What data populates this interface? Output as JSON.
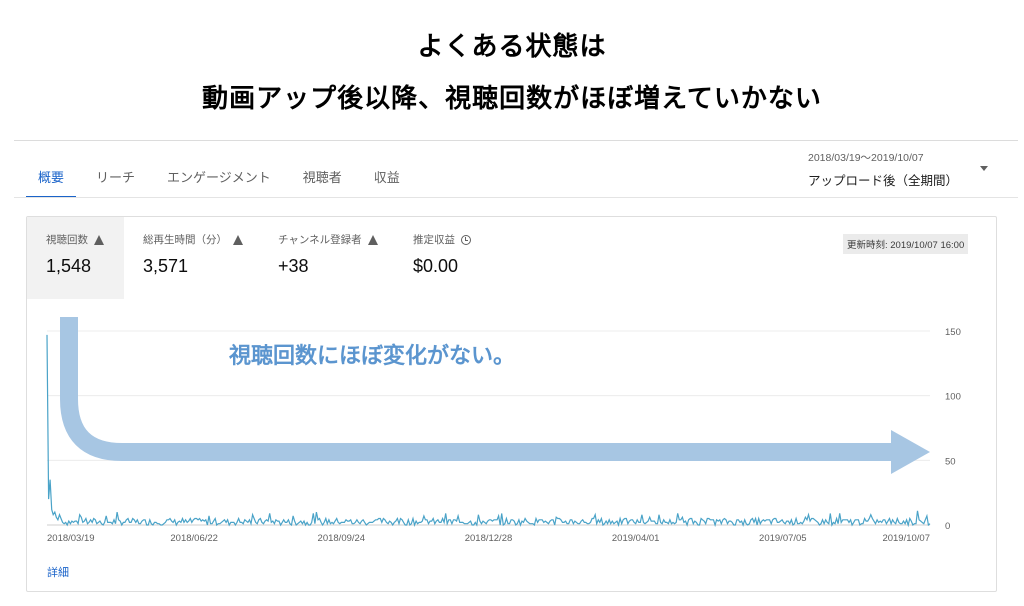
{
  "headline": {
    "line1": "よくある状態は",
    "line2": "動画アップ後以降、視聴回数がほぼ増えていかない"
  },
  "tabs": [
    {
      "label": "概要",
      "active": true
    },
    {
      "label": "リーチ",
      "active": false
    },
    {
      "label": "エンゲージメント",
      "active": false
    },
    {
      "label": "視聴者",
      "active": false
    },
    {
      "label": "収益",
      "active": false
    }
  ],
  "range": {
    "dates": "2018/03/19〜2019/10/07",
    "label": "アップロード後（全期間）"
  },
  "metrics": [
    {
      "label": "視聴回数",
      "value": "1,548",
      "icon": "warning-icon",
      "selected": true
    },
    {
      "label": "総再生時間（分）",
      "value": "3,571",
      "icon": "warning-icon",
      "selected": false
    },
    {
      "label": "チャンネル登録者",
      "value": "+38",
      "icon": "warning-icon",
      "selected": false
    },
    {
      "label": "推定収益",
      "value": "$0.00",
      "icon": "clock-icon",
      "selected": false
    }
  ],
  "updated": "更新時刻: 2019/10/07 16:00",
  "detail_link": "詳細",
  "annotation": {
    "text": "視聴回数にほぼ変化がない。",
    "arrow_color": "#a7c6e3",
    "text_color": "#5b95cf"
  },
  "colors": {
    "accent": "#1a63c9",
    "line": "#4aa3c8"
  },
  "chart_data": {
    "type": "line",
    "series": [
      {
        "values_first_days": [
          147,
          20,
          35,
          12,
          8,
          10,
          6,
          4,
          8,
          5
        ],
        "typical_daily_range": [
          0,
          8
        ]
      }
    ],
    "x_tick_labels": [
      "2018/03/19",
      "2018/06/22",
      "2018/09/24",
      "2018/12/28",
      "2019/04/01",
      "2019/07/05",
      "2019/10/07"
    ],
    "y_tick_labels": [
      "150",
      "100",
      "50",
      "0"
    ],
    "ylim": [
      0,
      150
    ],
    "xlim": [
      "2018/03/19",
      "2019/10/07"
    ],
    "grid": true
  }
}
